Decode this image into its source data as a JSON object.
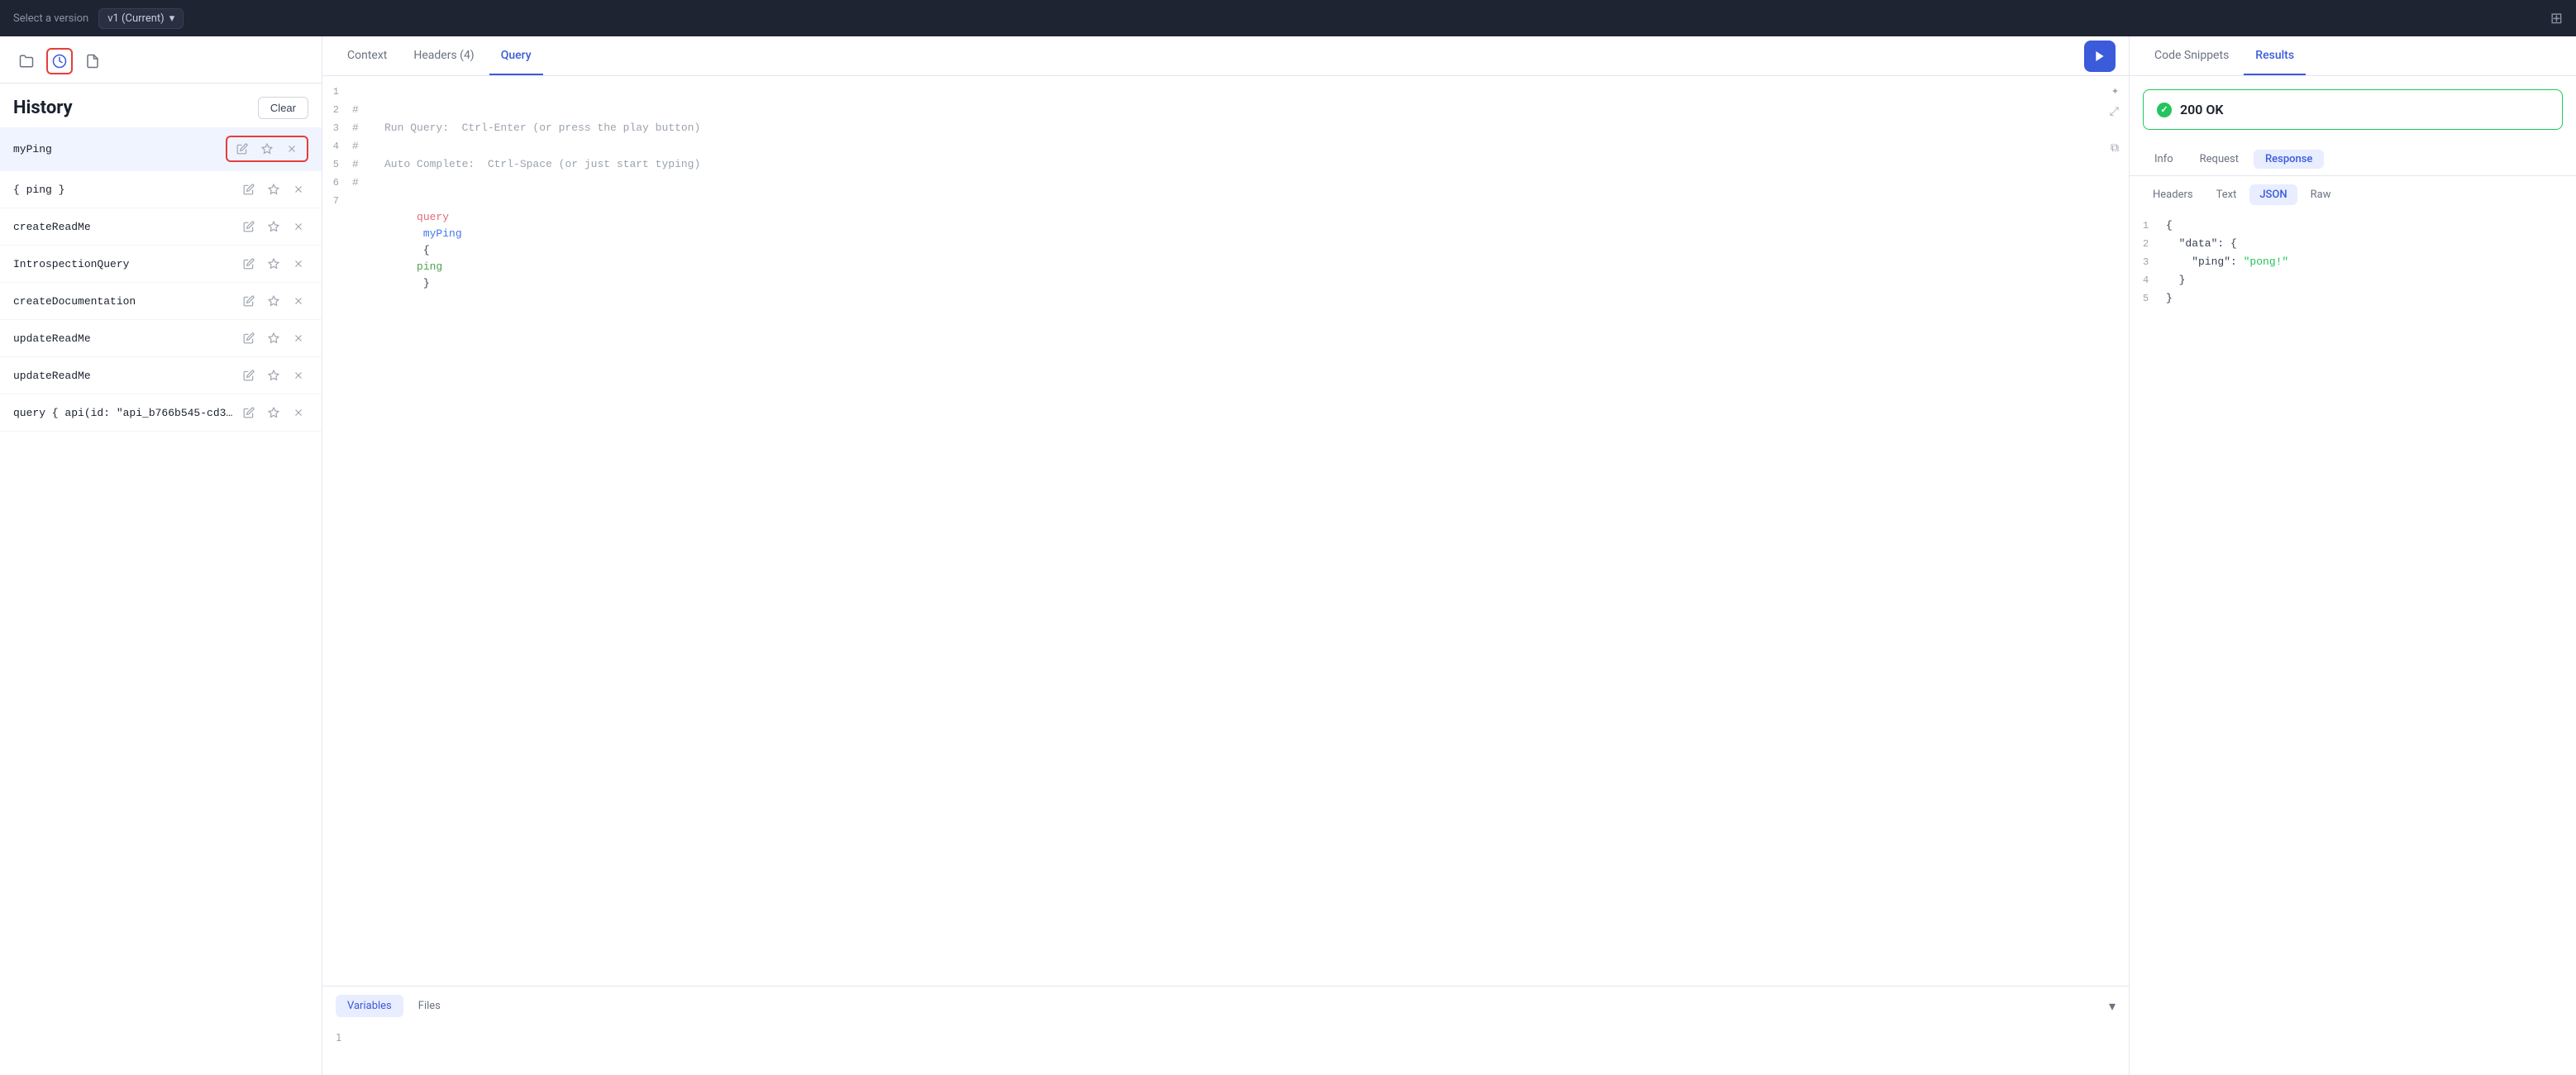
{
  "topbar": {
    "label": "Select a version",
    "version": "v1 (Current)",
    "grid_icon": "⊞"
  },
  "sidebar": {
    "history_icon_tooltip": "history",
    "save_icon_tooltip": "save",
    "title": "History",
    "clear_btn": "Clear",
    "items": [
      {
        "name": "myPing",
        "selected": true
      },
      {
        "name": "{ ping }",
        "selected": false
      },
      {
        "name": "createReadMe",
        "selected": false
      },
      {
        "name": "IntrospectionQuery",
        "selected": false
      },
      {
        "name": "createDocumentation",
        "selected": false
      },
      {
        "name": "updateReadMe",
        "selected": false
      },
      {
        "name": "updateReadMe",
        "selected": false
      },
      {
        "name": "query { api(id: \"api_b766b545-cd34...",
        "selected": false
      }
    ]
  },
  "center": {
    "tabs": [
      {
        "label": "Context",
        "active": false
      },
      {
        "label": "Headers (4)",
        "active": false
      },
      {
        "label": "Query",
        "active": true
      }
    ],
    "run_btn_icon": "▶",
    "code_lines": [
      {
        "num": 1,
        "content": "",
        "type": "plain"
      },
      {
        "num": 2,
        "content": "#",
        "type": "comment"
      },
      {
        "num": 3,
        "content": "#    Run Query:  Ctrl-Enter (or press the play button)",
        "type": "comment"
      },
      {
        "num": 4,
        "content": "#",
        "type": "comment"
      },
      {
        "num": 5,
        "content": "#    Auto Complete:  Ctrl-Space (or just start typing)",
        "type": "comment"
      },
      {
        "num": 6,
        "content": "#",
        "type": "comment"
      },
      {
        "num": 7,
        "content": "query myPing { ping }",
        "type": "query"
      }
    ],
    "bottom_tabs": [
      {
        "label": "Variables",
        "active": true
      },
      {
        "label": "Files",
        "active": false
      }
    ],
    "bottom_line_num": "1"
  },
  "right": {
    "tabs": [
      {
        "label": "Code Snippets",
        "active": false
      },
      {
        "label": "Results",
        "active": true
      }
    ],
    "status": "200 OK",
    "sub_tabs": [
      {
        "label": "Info",
        "active": false
      },
      {
        "label": "Request",
        "active": false
      },
      {
        "label": "Response",
        "active": true
      }
    ],
    "format_tabs": [
      {
        "label": "Headers",
        "active": false
      },
      {
        "label": "Text",
        "active": false
      },
      {
        "label": "JSON",
        "active": true
      },
      {
        "label": "Raw",
        "active": false
      }
    ],
    "json_lines": [
      {
        "num": 1,
        "content": "{"
      },
      {
        "num": 2,
        "content": "  \"data\": {"
      },
      {
        "num": 3,
        "content": "    \"ping\": \"pong!\"",
        "has_string": true,
        "key": "    \"ping\": ",
        "value": "\"pong!\""
      },
      {
        "num": 4,
        "content": "  }"
      },
      {
        "num": 5,
        "content": "}"
      }
    ]
  }
}
